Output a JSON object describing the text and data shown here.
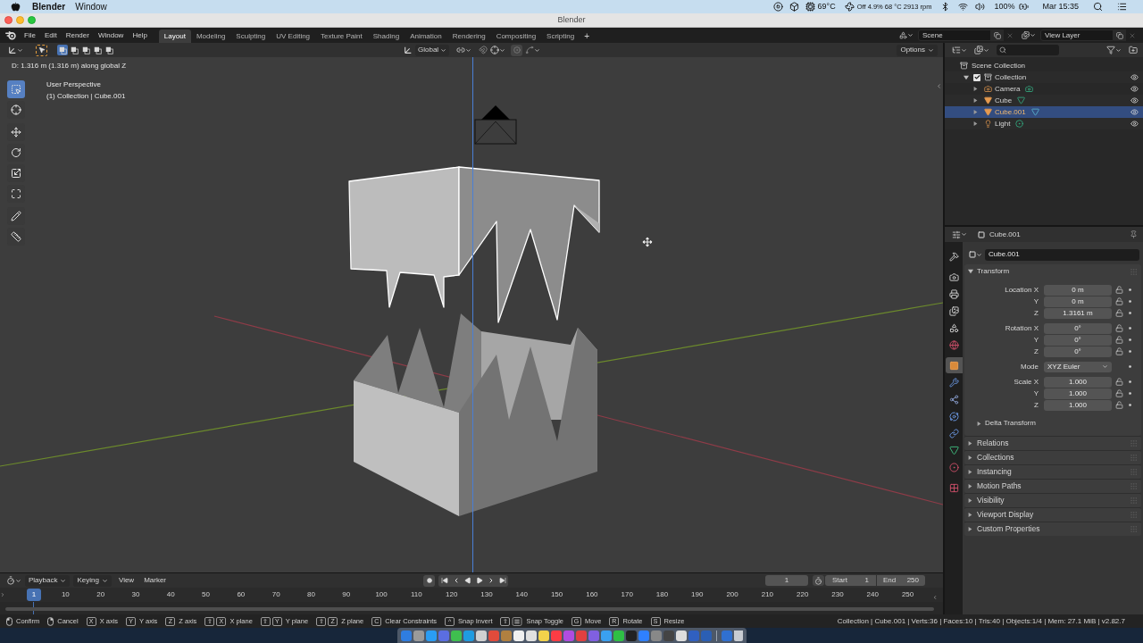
{
  "mac_menubar": {
    "app_name": "Blender",
    "menus": [
      "Window"
    ],
    "cpu_temperature": "69°C",
    "fan_status": "Off 4.9% 68 °C 2913 rpm",
    "battery_level_text": "100%",
    "clock": "Mar 15:35"
  },
  "window": {
    "title": "Blender"
  },
  "topbar": {
    "menus": [
      "File",
      "Edit",
      "Render",
      "Window",
      "Help"
    ],
    "workspaces": [
      {
        "label": "Layout",
        "selected": true
      },
      {
        "label": "Modeling",
        "selected": false
      },
      {
        "label": "Sculpting",
        "selected": false
      },
      {
        "label": "UV Editing",
        "selected": false
      },
      {
        "label": "Texture Paint",
        "selected": false
      },
      {
        "label": "Shading",
        "selected": false
      },
      {
        "label": "Animation",
        "selected": false
      },
      {
        "label": "Rendering",
        "selected": false
      },
      {
        "label": "Compositing",
        "selected": false
      },
      {
        "label": "Scripting",
        "selected": false
      }
    ],
    "add_workspace": "+",
    "scene": "Scene",
    "view_layer": "View Layer"
  },
  "viewport": {
    "select_modes": [
      {
        "selected": true
      },
      {
        "selected": false
      },
      {
        "selected": false
      },
      {
        "selected": false
      },
      {
        "selected": false
      }
    ],
    "orientation": "Global",
    "options": "Options",
    "operator_info": "D: 1.316 m (1.316 m) along global Z",
    "view_name": "User Perspective",
    "object_info": "(1) Collection | Cube.001",
    "tool_groups": [
      {
        "tools": [
          {
            "kind": "select_box",
            "selected": true
          },
          {
            "kind": "cursor",
            "selected": false
          }
        ]
      },
      {
        "tools": [
          {
            "kind": "move",
            "selected": false
          },
          {
            "kind": "rotate",
            "selected": false
          },
          {
            "kind": "scale",
            "selected": false
          },
          {
            "kind": "transform",
            "selected": false
          }
        ]
      },
      {
        "tools": [
          {
            "kind": "annotate",
            "selected": false
          },
          {
            "kind": "measure",
            "selected": false
          }
        ]
      }
    ]
  },
  "outliner": {
    "root": {
      "label": "Scene Collection",
      "selected": false
    },
    "collections": [
      {
        "label": "Collection",
        "checked": true,
        "expanded": true,
        "visible": true,
        "selected": false,
        "children": [
          {
            "label": "Camera",
            "kind": "camera",
            "visible": true,
            "selected": false
          },
          {
            "label": "Cube",
            "kind": "mesh",
            "visible": true,
            "selected": false
          },
          {
            "label": "Cube.001",
            "kind": "mesh",
            "visible": true,
            "selected": true
          },
          {
            "label": "Light",
            "kind": "light",
            "visible": true,
            "selected": false
          }
        ]
      }
    ]
  },
  "properties": {
    "context_name": "Cube.001",
    "object_name": "Cube.001",
    "tab_groups": [
      {
        "tabs": [
          {
            "kind": "tool",
            "selected": false
          }
        ]
      },
      {
        "tabs": [
          {
            "kind": "render",
            "selected": false
          },
          {
            "kind": "output",
            "selected": false
          },
          {
            "kind": "view_layer",
            "selected": false
          },
          {
            "kind": "scene",
            "selected": false
          },
          {
            "kind": "world",
            "selected": false
          }
        ]
      },
      {
        "tabs": [
          {
            "kind": "object",
            "selected": true
          },
          {
            "kind": "modifiers",
            "selected": false
          },
          {
            "kind": "particles",
            "selected": false
          },
          {
            "kind": "physics",
            "selected": false
          },
          {
            "kind": "constraints",
            "selected": false
          },
          {
            "kind": "data",
            "selected": false
          },
          {
            "kind": "material",
            "selected": false
          }
        ]
      },
      {
        "tabs": [
          {
            "kind": "texture",
            "selected": false
          }
        ]
      }
    ],
    "transform": {
      "title": "Transform",
      "expanded": true,
      "groups": [
        {
          "rows": [
            {
              "kind": "number",
              "label": "Location X",
              "value": "0 m"
            },
            {
              "kind": "number",
              "label": "Y",
              "value": "0 m"
            },
            {
              "kind": "number",
              "label": "Z",
              "value": "1.3161 m"
            }
          ]
        },
        {
          "rows": [
            {
              "kind": "number",
              "label": "Rotation X",
              "value": "0°"
            },
            {
              "kind": "number",
              "label": "Y",
              "value": "0°"
            },
            {
              "kind": "number",
              "label": "Z",
              "value": "0°"
            }
          ]
        },
        {
          "rows": [
            {
              "kind": "dropdown",
              "label": "Mode",
              "value": "XYZ Euler"
            }
          ]
        },
        {
          "rows": [
            {
              "kind": "number",
              "label": "Scale X",
              "value": "1.000"
            },
            {
              "kind": "number",
              "label": "Y",
              "value": "1.000"
            },
            {
              "kind": "number",
              "label": "Z",
              "value": "1.000"
            }
          ]
        }
      ],
      "subpanels": [
        {
          "label": "Delta Transform",
          "expanded": false
        }
      ]
    },
    "panels": [
      {
        "label": "Relations",
        "expanded": false
      },
      {
        "label": "Collections",
        "expanded": false
      },
      {
        "label": "Instancing",
        "expanded": false
      },
      {
        "label": "Motion Paths",
        "expanded": false
      },
      {
        "label": "Visibility",
        "expanded": false
      },
      {
        "label": "Viewport Display",
        "expanded": false
      },
      {
        "label": "Custom Properties",
        "expanded": false
      }
    ]
  },
  "timeline": {
    "menus": [
      {
        "kind": "dropdown",
        "label": "Playback"
      },
      {
        "kind": "dropdown",
        "label": "Keying"
      },
      {
        "kind": "menu",
        "label": "View"
      },
      {
        "kind": "menu",
        "label": "Marker"
      }
    ],
    "current_frame": "1",
    "start": {
      "label": "Start",
      "value": "1"
    },
    "end": {
      "label": "End",
      "value": "250"
    },
    "playhead": "1",
    "frame_labels": [
      "10",
      "20",
      "30",
      "40",
      "50",
      "60",
      "70",
      "80",
      "90",
      "100",
      "110",
      "120",
      "130",
      "140",
      "150",
      "160",
      "170",
      "180",
      "190",
      "200",
      "210",
      "220",
      "230",
      "240",
      "250"
    ]
  },
  "status_bar": {
    "hints": [
      {
        "keys": [
          {
            "kind": "mouse_left"
          }
        ],
        "label": "Confirm"
      },
      {
        "keys": [
          {
            "kind": "mouse_right"
          }
        ],
        "label": "Cancel"
      },
      {
        "keys": [
          {
            "kind": "key",
            "label": "X"
          }
        ],
        "label": "X axis"
      },
      {
        "keys": [
          {
            "kind": "key",
            "label": "Y"
          }
        ],
        "label": "Y axis"
      },
      {
        "keys": [
          {
            "kind": "key",
            "label": "Z"
          }
        ],
        "label": "Z axis"
      },
      {
        "keys": [
          {
            "kind": "key",
            "label": "⇧"
          },
          {
            "kind": "key",
            "label": "X"
          }
        ],
        "label": "X plane"
      },
      {
        "keys": [
          {
            "kind": "key",
            "label": "⇧"
          },
          {
            "kind": "key",
            "label": "Y"
          }
        ],
        "label": "Y plane"
      },
      {
        "keys": [
          {
            "kind": "key",
            "label": "⇧"
          },
          {
            "kind": "key",
            "label": "Z"
          }
        ],
        "label": "Z plane"
      },
      {
        "keys": [
          {
            "kind": "key",
            "label": "C"
          }
        ],
        "label": "Clear Constraints"
      },
      {
        "keys": [
          {
            "kind": "key",
            "label": "^"
          }
        ],
        "label": "Snap Invert"
      },
      {
        "keys": [
          {
            "kind": "key",
            "label": "⇧"
          },
          {
            "kind": "tab_key"
          }
        ],
        "label": "Snap Toggle"
      },
      {
        "keys": [
          {
            "kind": "key",
            "label": "G"
          }
        ],
        "label": "Move"
      },
      {
        "keys": [
          {
            "kind": "key",
            "label": "R"
          }
        ],
        "label": "Rotate"
      },
      {
        "keys": [
          {
            "kind": "key",
            "label": "S"
          }
        ],
        "label": "Resize"
      }
    ],
    "stats": "Collection | Cube.001 | Verts:36 | Faces:10 | Tris:40 | Objects:1/4 | Mem: 27.1 MiB | v2.82.7"
  }
}
